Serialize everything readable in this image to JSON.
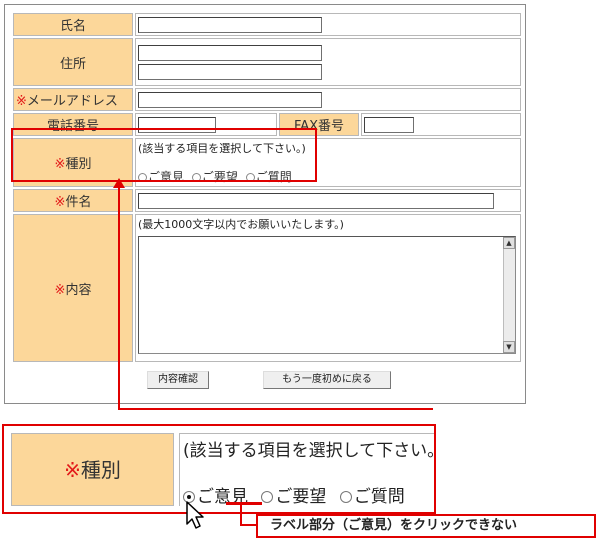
{
  "form": {
    "name_label": "氏名",
    "address_label": "住所",
    "email_required_mark": "※",
    "email_label": "メールアドレス",
    "phone_label": "電話番号",
    "fax_label": "FAX番号",
    "type_required_mark": "※",
    "type_label": "種別",
    "type_note": "(該当する項目を選択して下さい。)",
    "type_options": [
      "ご意見",
      "ご要望",
      "ご質問"
    ],
    "subject_required_mark": "※",
    "subject_label": "件名",
    "content_required_mark": "※",
    "content_label": "内容",
    "content_note": "(最大1000文字以内でお願いいたします。)",
    "confirm_button": "内容確認",
    "reset_button": "もう一度初めに戻る"
  },
  "zoom": {
    "required_mark": "※",
    "label": "種別",
    "note": "(該当する項目を選択して下さい。",
    "options": [
      "ご意見",
      "ご要望",
      "ご質問"
    ],
    "selected_index": 0
  },
  "callout": {
    "text": "ラベル部分（ご意見）をクリックできない"
  },
  "colors": {
    "label_bg": "#fcd79a",
    "required": "#e21919",
    "highlight": "#e00000"
  }
}
